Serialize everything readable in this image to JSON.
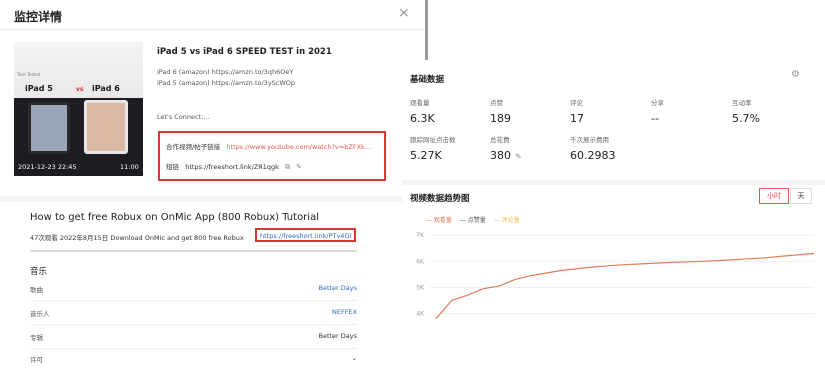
{
  "left": {
    "title": "监控详情",
    "close": "×",
    "thumbnail": {
      "small_text": "Tech Tested",
      "label_a": "iPad 5",
      "vs": "vs",
      "label_b": "iPad 6",
      "date": "2021-12-23 22:45",
      "duration": "11:00"
    },
    "video_title": "iPad 5 vs iPad 6 SPEED TEST in 2021",
    "desc_lines": [
      "iPad 6 (amazon) https://amzn.to/3qh6OeY",
      "iPad 5 (amazon) https://amzn.to/3yScWOp",
      "Let's Connect:..."
    ],
    "link_box": {
      "row1_label": "合作视频/帖子链接",
      "row1_link": "https://www.youtube.com/watch?v=bZFXk...",
      "row2_label": "短链",
      "row2_link": "https://freeshort.link/ZR1qgk",
      "copy_icon": "⧉",
      "edit_icon": "✎"
    },
    "second": {
      "title": "How to get free Robux on OnMic App (800 Robux) Tutorial",
      "meta": "47次观看  2022年8月15日  Download OnMic and get 800 free Robux",
      "meta_link": "https://freeshort.link/PTv4Gl"
    },
    "music": {
      "heading": "音乐",
      "rows": [
        {
          "key": "歌曲",
          "value": "Better Days"
        },
        {
          "key": "音乐人",
          "value": "NEFFEX"
        },
        {
          "key": "专辑",
          "value": "Better Days"
        },
        {
          "key": "许可",
          "value": "⌄"
        }
      ]
    }
  },
  "right": {
    "title": "基础数据",
    "gear_icon": "⚙",
    "stats_row1": [
      {
        "label": "观看量",
        "value": "6.3K"
      },
      {
        "label": "点赞",
        "value": "189"
      },
      {
        "label": "评论",
        "value": "17"
      },
      {
        "label": "分享",
        "value": "--"
      },
      {
        "label": "互动率",
        "value": "5.7%"
      }
    ],
    "stats_row2": [
      {
        "label": "跟踪网址点击数",
        "value": "5.27K"
      },
      {
        "label": "总花费",
        "value": "380"
      },
      {
        "label": "千次展示费用",
        "value": "60.2983"
      }
    ],
    "edit_icon": "✎",
    "trend_title": "视频数据趋势图",
    "toggle_on": "小时",
    "toggle_off": "天",
    "legend": [
      {
        "label": "— 观看量",
        "color": "#e07b55"
      },
      {
        "label": "— 点赞量",
        "color": "#555555"
      },
      {
        "label": "— 评论量",
        "color": "#e8b84a"
      }
    ]
  },
  "chart_data": {
    "type": "line",
    "ylim": [
      3.75,
      7.2
    ],
    "yticks": [
      "7K",
      "6K",
      "5K",
      "4K"
    ],
    "ytick_values": [
      7,
      6,
      5,
      4
    ],
    "series": [
      {
        "name": "观看量",
        "color": "#e07b55",
        "values": [
          3.8,
          4.5,
          4.7,
          4.95,
          5.05,
          5.3,
          5.45,
          5.55,
          5.65,
          5.72,
          5.78,
          5.83,
          5.87,
          5.9,
          5.93,
          5.96,
          5.98,
          6.0,
          6.03,
          6.06,
          6.1,
          6.14,
          6.2,
          6.25,
          6.3
        ]
      }
    ]
  }
}
